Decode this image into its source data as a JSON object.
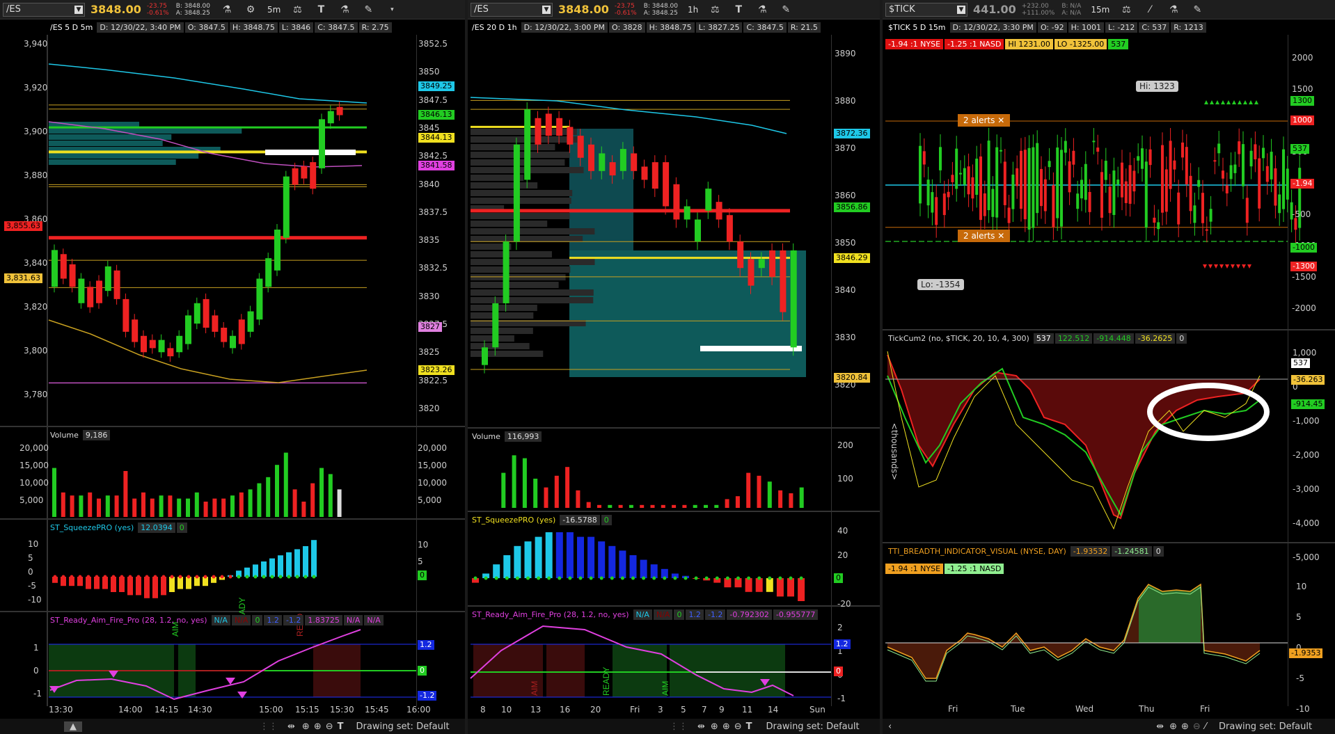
{
  "panels": [
    {
      "symbol": "/ES",
      "price": "3848.00",
      "change": "-23.75",
      "change_pct": "-0.61%",
      "bid": "B: 3848.00",
      "ask": "A: 3848.25",
      "timeframe": "5m",
      "info": [
        "/ES 5 D 5m",
        "D: 12/30/22, 3:40 PM",
        "O: 3847.5",
        "H: 3848.75",
        "L: 3846",
        "C: 3847.5",
        "R: 2.75"
      ],
      "left_axis": [
        "3,940",
        "3,920",
        "3,900",
        "3,880",
        "3,860",
        "3,840",
        "3,820",
        "3,800",
        "3,780"
      ],
      "right_axis": [
        "3852.5",
        "3850",
        "3847.5",
        "3845",
        "3842.5",
        "3840",
        "3837.5",
        "3835",
        "3832.5",
        "3830",
        "3827.5",
        "3825",
        "3822.5",
        "3820"
      ],
      "price_labels": [
        {
          "text": "3849.25",
          "color": "#1ec8e8"
        },
        {
          "text": "3846.13",
          "color": "#22cc22"
        },
        {
          "text": "3844.13",
          "color": "#f0e020"
        },
        {
          "text": "3841.58",
          "color": "#e040e0"
        },
        {
          "text": "3827",
          "color": "#e080e0"
        },
        {
          "text": "3823.26",
          "color": "#f0e020"
        },
        {
          "text": "3,855.63",
          "color": "#ee2222"
        },
        {
          "text": "3,831.63",
          "color": "#f0c23a"
        }
      ],
      "volume_title": "Volume",
      "volume_value": "9,186",
      "volume_axis": [
        "20,000",
        "15,000",
        "10,000",
        "5,000"
      ],
      "squeeze_title": "ST_SqueezePRO (yes)",
      "squeeze_value": "12.0394",
      "squeeze_zero": "0",
      "squeeze_axis": [
        "10",
        "5",
        "0",
        "-5",
        "-10"
      ],
      "raf_title": "ST_Ready_Aim_Fire_Pro (28, 1.2, no, yes)",
      "raf_values": [
        "N/A",
        "N/A",
        "0",
        "1.2",
        "-1.2",
        "1.83725",
        "N/A",
        "N/A"
      ],
      "raf_axis": [
        "1",
        "0",
        "-1"
      ],
      "raf_labels": [
        "1.2",
        "0",
        "-1.2"
      ],
      "raf_text": [
        "AIM",
        "READY",
        "READ"
      ],
      "time_axis": [
        "13:30",
        "14:00",
        "14:15",
        "14:30",
        "15:00",
        "15:15",
        "15:30",
        "15:45",
        "16:00"
      ]
    },
    {
      "symbol": "/ES",
      "price": "3848.00",
      "change": "-23.75",
      "change_pct": "-0.61%",
      "bid": "B: 3848.00",
      "ask": "A: 3848.25",
      "timeframe": "1h",
      "info": [
        "/ES 20 D 1h",
        "D: 12/30/22, 3:00 PM",
        "O: 3828",
        "H: 3848.75",
        "L: 3827.25",
        "C: 3847.5",
        "R: 21.5"
      ],
      "right_axis": [
        "3890",
        "3880",
        "3870",
        "3860",
        "3850",
        "3840",
        "3830",
        "3820"
      ],
      "price_labels": [
        {
          "text": "3872.36",
          "color": "#1ec8e8"
        },
        {
          "text": "3856.86",
          "color": "#22cc22"
        },
        {
          "text": "3846.29",
          "color": "#f0e020"
        },
        {
          "text": "3820.84",
          "color": "#f0c23a"
        }
      ],
      "volume_title": "Volume",
      "volume_value": "116,993",
      "volume_axis": [
        "200",
        "100"
      ],
      "volume_unit": "<thousands>",
      "squeeze_title": "ST_SqueezePRO (yes)",
      "squeeze_value": "-16.5788",
      "squeeze_zero": "0",
      "squeeze_axis": [
        "40",
        "20",
        "0",
        "-20"
      ],
      "raf_title": "ST_Ready_Aim_Fire_Pro (28, 1.2, no, yes)",
      "raf_values": [
        "N/A",
        "N/A",
        "0",
        "1.2",
        "-1.2",
        "-0.792302",
        "-0.955777"
      ],
      "raf_axis": [
        "2",
        "1",
        "0",
        "-1"
      ],
      "raf_labels": [
        "1.2",
        "0"
      ],
      "raf_text": [
        "AIM",
        "READY",
        "AIM"
      ],
      "time_axis": [
        "8",
        "10",
        "13",
        "16",
        "20",
        "Fri",
        "3",
        "5",
        "7",
        "9",
        "11",
        "14",
        "Sun"
      ]
    },
    {
      "symbol": "$TICK",
      "price": "441.00",
      "change": "+232.00",
      "change_pct": "+111.00%",
      "bid": "B: N/A",
      "ask": "A: N/A",
      "timeframe": "15m",
      "info": [
        "$TICK 5 D 15m",
        "D: 12/30/22, 3:30 PM",
        "O: -92",
        "H: 1001",
        "L: -212",
        "C: 537",
        "R: 1213"
      ],
      "breadth_tags": [
        {
          "text": "-1.94 :1 NYSE",
          "bg": "#e01010",
          "fg": "#fff"
        },
        {
          "text": "-1.25 :1 NASD",
          "bg": "#e01010",
          "fg": "#fff"
        },
        {
          "text": "HI 1231.00",
          "bg": "#f0c23a",
          "fg": "#000"
        },
        {
          "text": "LO -1325.00",
          "bg": "#f0c23a",
          "fg": "#000"
        },
        {
          "text": "537",
          "bg": "#22cc22",
          "fg": "#000"
        }
      ],
      "right_axis": [
        "2000",
        "1500",
        "1000",
        "500",
        "0",
        "-500",
        "-1000",
        "-1500",
        "-2000"
      ],
      "price_labels": [
        {
          "text": "1300",
          "color": "#22cc22"
        },
        {
          "text": "1000",
          "color": "#ee2222"
        },
        {
          "text": "537",
          "color": "#22cc22"
        },
        {
          "text": "-1.94",
          "color": "#ee2222"
        },
        {
          "text": "-1000",
          "color": "#22cc22"
        },
        {
          "text": "-1300",
          "color": "#ee2222"
        }
      ],
      "alerts": [
        "2 alerts",
        "2 alerts"
      ],
      "hi_tip": "Hi: 1323",
      "lo_tip": "Lo: -1354",
      "tickcum_title": "TickCum2 (no, $TICK, 20, 10, 4, 300)",
      "tickcum_values": [
        "537",
        "122.512",
        "-914.448",
        "-36.2625",
        "0"
      ],
      "tickcum_axis": [
        "1,000",
        "0",
        "-1,000",
        "-2,000",
        "-3,000",
        "-4,000",
        "-5,000"
      ],
      "tickcum_labels": [
        {
          "text": "537",
          "color": "#ffffff"
        },
        {
          "text": "-36.263",
          "color": "#f0c23a"
        },
        {
          "text": "-914.45",
          "color": "#22cc22"
        }
      ],
      "tti_title": "TTI_BREADTH_INDICATOR_VISUAL (NYSE, DAY)",
      "tti_values": [
        "-1.93532",
        "-1.24581",
        "0"
      ],
      "tti_tags": [
        {
          "text": "-1.94 :1 NYSE",
          "bg": "#f0a020",
          "fg": "#000"
        },
        {
          "text": "-1.25 :1 NASD",
          "bg": "#90ee90",
          "fg": "#000"
        }
      ],
      "tti_axis": [
        "10",
        "5",
        "0",
        "-5",
        "-10"
      ],
      "tti_label": "-1.9353",
      "time_axis": [
        "Fri",
        "Tue",
        "Wed",
        "Thu",
        "Fri"
      ]
    }
  ],
  "footer": {
    "drawing_set": "Drawing set: Default"
  }
}
